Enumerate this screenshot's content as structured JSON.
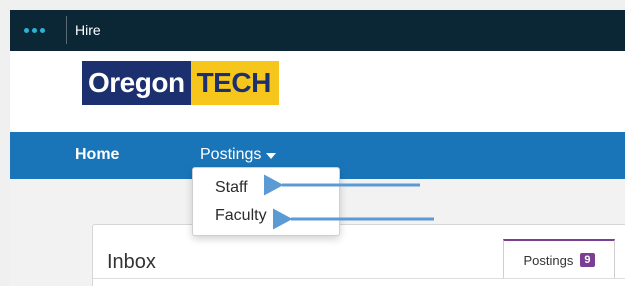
{
  "topbar": {
    "app_title": "Hire",
    "apps_icon": "dots-menu-icon"
  },
  "logo": {
    "part1": "Oregon",
    "part2": "TECH"
  },
  "nav": {
    "home": "Home",
    "postings": "Postings",
    "postings_icon": "caret-down-icon"
  },
  "dropdown": {
    "items": [
      "Staff",
      "Faculty"
    ]
  },
  "inbox": {
    "title": "Inbox",
    "tab_label": "Postings",
    "tab_count": "9"
  },
  "colors": {
    "topbar": "#0b2635",
    "navbar": "#1a75b8",
    "logo_blue": "#1c2f6e",
    "logo_yellow": "#f6c61c",
    "badge": "#7a3e92",
    "arrow": "#5b9bd5"
  }
}
